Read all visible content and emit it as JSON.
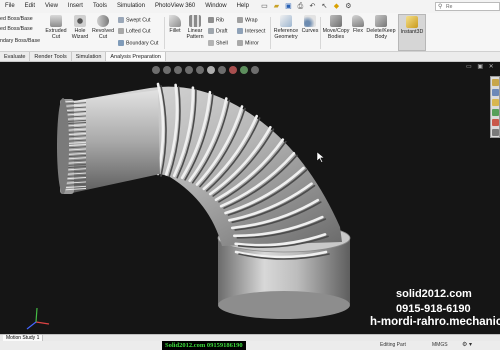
{
  "menu": [
    "File",
    "Edit",
    "View",
    "Insert",
    "Tools",
    "Simulation",
    "PhotoView 360",
    "Window",
    "Help"
  ],
  "search": {
    "placeholder": "Re"
  },
  "ribbon": {
    "boss_base": [
      "ed Boss/Base",
      "ed Boss/Base",
      "ndary Boss/Base"
    ],
    "extruded_cut": [
      "Extruded",
      "Cut"
    ],
    "hole_wizard": [
      "Hole",
      "Wizard"
    ],
    "revolved_cut": [
      "Revolved",
      "Cut"
    ],
    "swept_cut": "Swept Cut",
    "lofted_cut": "Lofted Cut",
    "boundary_cut": "Boundary Cut",
    "fillet": "Fillet",
    "linear_pattern": [
      "Linear",
      "Pattern"
    ],
    "rib": "Rib",
    "draft": "Draft",
    "shell": "Shell",
    "wrap": "Wrap",
    "intersect": "Intersect",
    "mirror": "Mirror",
    "reference_geometry": [
      "Reference",
      "Geometry"
    ],
    "curves": "Curves",
    "move_copy": [
      "Move/Copy",
      "Bodies"
    ],
    "flex": "Flex",
    "delete_keep": [
      "Delete/Keep",
      "Body"
    ],
    "instant3d": "Instant3D"
  },
  "tabs": [
    "Evaluate",
    "Render Tools",
    "Simulation",
    "Analysis Preparation"
  ],
  "watermark": {
    "line1": "solid2012.com",
    "line2": "0915-918-6190",
    "line3": "h-mordi-rahro.mechanic"
  },
  "bottom_tab": "Motion Study 1",
  "status": {
    "watermark": "Solid2012.com 09159186190",
    "editing": "Editing Part",
    "units": "MMGS",
    "gear": "⚙ ▾"
  },
  "colors": {
    "viewport_bg": "#151515",
    "model": "#bdbdbd",
    "watermark_green": "#3ddc3d",
    "accent_yellow": "#e8c440"
  },
  "icons": {
    "quick_access": [
      "new-icon",
      "open-icon",
      "save-icon",
      "print-icon",
      "undo-icon",
      "select-icon",
      "rebuild-icon",
      "options-icon"
    ],
    "heads_up": [
      "zoom-to-fit-icon",
      "zoom-area-icon",
      "previous-view-icon",
      "section-view-icon",
      "view-orientation-icon",
      "display-style-icon",
      "hide-show-icon",
      "appearance-icon",
      "scene-icon",
      "view-settings-icon"
    ],
    "task_pane": [
      "resources-icon",
      "design-library-icon",
      "file-explorer-icon",
      "view-palette-icon",
      "appearances-icon",
      "custom-properties-icon"
    ]
  }
}
